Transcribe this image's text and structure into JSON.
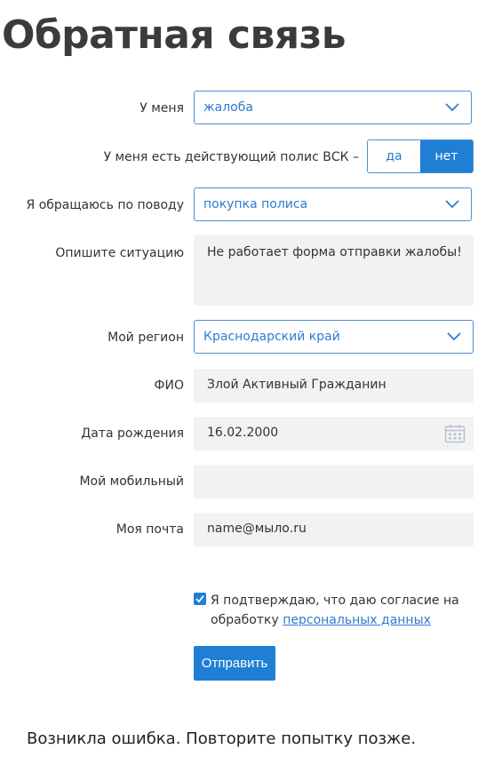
{
  "page": {
    "title": "Обратная связь"
  },
  "form": {
    "type": {
      "label": "У меня",
      "value": "жалоба"
    },
    "policy": {
      "label": "У меня есть действующий полис ВСК –",
      "yes": "да",
      "no": "нет",
      "selected": "нет"
    },
    "reason": {
      "label": "Я обращаюсь по поводу",
      "value": "покупка полиса"
    },
    "situation": {
      "label": "Опишите ситуацию",
      "value": "Не работает форма отправки жалобы!"
    },
    "region": {
      "label": "Мой регион",
      "value": "Краснодарский край"
    },
    "fio": {
      "label": "ФИО",
      "value": "Злой Активный Гражданин"
    },
    "birthdate": {
      "label": "Дата рождения",
      "value": "16.02.2000"
    },
    "mobile": {
      "label": "Мой мобильный",
      "value": ""
    },
    "email": {
      "label": "Моя почта",
      "value": "name@мыло.ru"
    },
    "consent": {
      "checked": true,
      "text_line1": "Я подтверждаю, что даю согласие на",
      "text_prefix": "обработку",
      "link": "персональных данных"
    },
    "submit_label": "Отправить"
  },
  "error_message": "Возникла ошибка. Повторите попытку позже.",
  "colors": {
    "accent": "#1e7fd4",
    "field_bg": "#f2f2f2"
  }
}
